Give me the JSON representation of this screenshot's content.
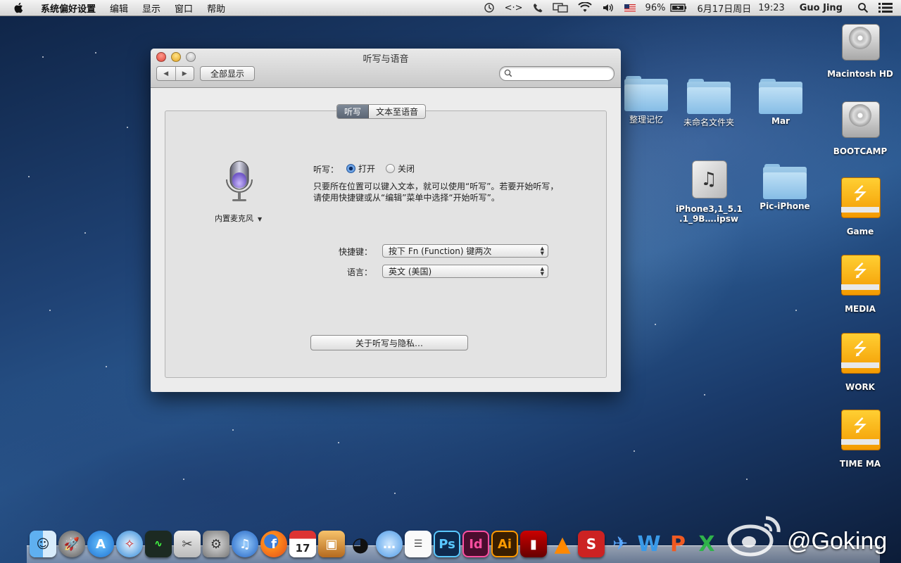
{
  "menubar": {
    "app_name": "系统偏好设置",
    "items": [
      "编辑",
      "显示",
      "窗口",
      "帮助"
    ],
    "status": {
      "battery": "96%",
      "date": "6月17日周日",
      "time": "19:23",
      "user": "Guo Jing"
    }
  },
  "window": {
    "title": "听写与语音",
    "show_all": "全部显示",
    "search_placeholder": "",
    "tabs": [
      "听写",
      "文本至语音"
    ],
    "active_tab": "听写",
    "mic_label": "内置麦克风",
    "dictation_label": "听写：",
    "radio_on": "打开",
    "radio_off": "关闭",
    "dictation_state": "打开",
    "description": "只要所在位置可以键入文本，就可以使用“听写”。若要开始听写，请使用快捷键或从“编辑”菜单中选择“开始听写”。",
    "shortcut_label": "快捷键：",
    "shortcut_value": "按下 Fn (Function) 键两次",
    "language_label": "语言：",
    "language_value": "英文 (美国)",
    "about_button": "关于听写与隐私…"
  },
  "desktop": {
    "folders": [
      "整理记忆",
      "未命名文件夹",
      "Mar",
      "Pic-iPhone"
    ],
    "ipsw_label_1": "iPhone3,1_5.1",
    "ipsw_label_2": ".1_9B….ipsw",
    "drives": [
      "Macintosh HD",
      "BOOTCAMP"
    ],
    "usb_drives": [
      "Game",
      "MEDIA",
      "WORK",
      "TIME MA"
    ]
  },
  "dock": {
    "calendar_day": "17",
    "apps": [
      "Finder",
      "Launchpad",
      "App Store",
      "Safari",
      "Activity Monitor",
      "Preview",
      "System Preferences",
      "iTunes",
      "Firefox",
      "Calendar",
      "iPhoto",
      "QQ",
      "Messages",
      "Notes",
      "Photoshop",
      "InDesign",
      "Illustrator",
      "Photo Booth",
      "VLC",
      "SBP",
      "Xcode",
      "Word",
      "PowerPoint",
      "Excel"
    ],
    "watermark": "@Goking"
  }
}
